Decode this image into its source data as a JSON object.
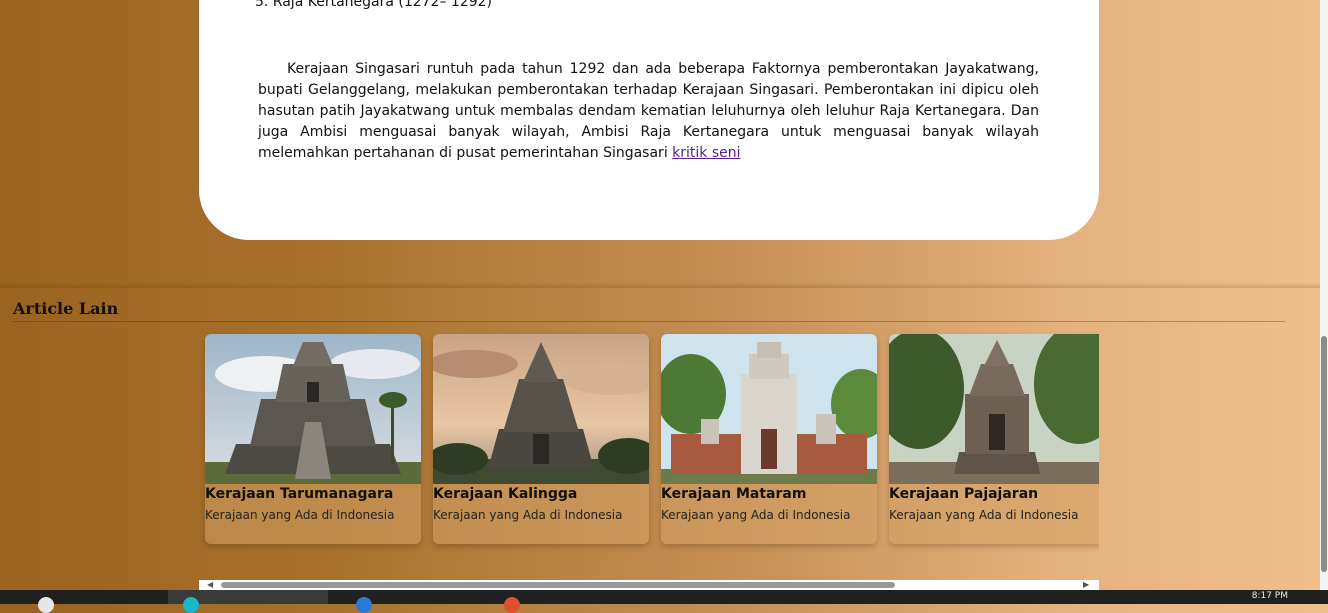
{
  "article": {
    "list_item": "5. Raja Kertanegara (1272– 1292)",
    "paragraph": "Kerajaan Singasari runtuh pada tahun 1292 dan ada beberapa Faktornya pemberontakan Jayakatwang, bupati Gelanggelang, melakukan pemberontakan terhadap Kerajaan Singasari. Pemberontakan ini dipicu oleh hasutan patih Jayakatwang untuk membalas dendam kematian leluhurnya oleh leluhur Raja Kertanegara. Dan juga Ambisi menguasai banyak wilayah, Ambisi Raja Kertanegara untuk menguasai banyak wilayah melemahkan pertahanan di pusat pemerintahan Singasari ",
    "link": "kritik seni"
  },
  "section": {
    "title": "Article Lain"
  },
  "cards": [
    {
      "title": "Kerajaan Tarumanagara",
      "desc": "Kerajaan yang Ada di Indonesia"
    },
    {
      "title": "Kerajaan Kalingga",
      "desc": "Kerajaan yang Ada di Indonesia"
    },
    {
      "title": "Kerajaan Mataram",
      "desc": "Kerajaan yang Ada di Indonesia"
    },
    {
      "title": "Kerajaan Pajajaran",
      "desc": "Kerajaan yang Ada di Indonesia"
    }
  ],
  "taskbar": {
    "clock": "8:17 PM"
  },
  "colors": {
    "link": "#5a1d8c",
    "page_gradient_start": "#9a6320",
    "page_gradient_end": "#efbf8c"
  }
}
